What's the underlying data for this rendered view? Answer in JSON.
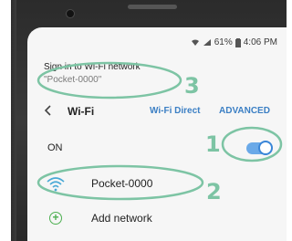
{
  "status_bar": {
    "battery": "61%",
    "time": "4:06 PM",
    "icons": [
      "wifi-icon",
      "signal-icon",
      "battery-icon"
    ]
  },
  "notification": {
    "title": "Sign in to Wi-Fi network",
    "network_quoted": "\"Pocket-0000\""
  },
  "toolbar": {
    "title": "Wi-Fi",
    "wifi_direct_label": "Wi-Fi Direct",
    "advanced_label": "ADVANCED"
  },
  "wifi_toggle": {
    "label": "ON",
    "state": "on",
    "accent_color": "#3a86d8"
  },
  "networks": [
    {
      "name": "Pocket-0000"
    }
  ],
  "add_network": {
    "label": "Add network"
  },
  "callouts": [
    "1",
    "2",
    "3"
  ],
  "colors": {
    "callout": "#7dc4a4",
    "link": "#3b7fc4",
    "add_icon": "#4caf50"
  }
}
